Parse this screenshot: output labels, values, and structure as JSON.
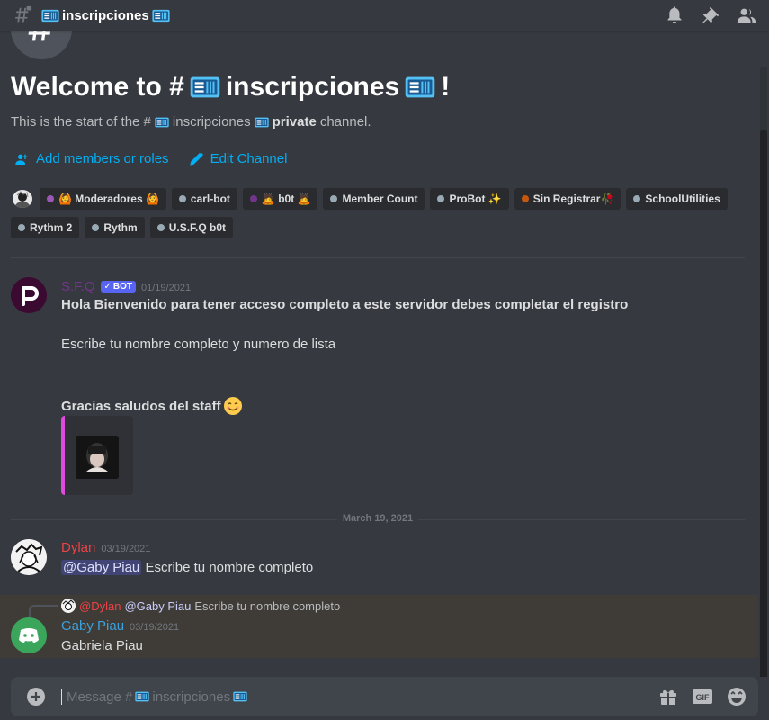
{
  "header": {
    "channel_name": "inscripciones",
    "icons": [
      "notification-bell-icon",
      "pin-icon",
      "member-list-icon"
    ]
  },
  "welcome": {
    "title_prefix": "Welcome to #",
    "channel_name": "inscripciones",
    "title_suffix": "!",
    "sub_prefix": "This is the start of the #",
    "sub_channel": "inscripciones",
    "sub_bold": "private",
    "sub_suffix": "channel.",
    "add_members_label": "Add members or roles",
    "edit_channel_label": "Edit Channel"
  },
  "roles": [
    {
      "label": "🙆 Moderadores 🙆",
      "color": "#9b59b6"
    },
    {
      "label": "carl-bot",
      "color": "#99aab5"
    },
    {
      "label": "🙇 b0t 🙇",
      "color": "#71368a"
    },
    {
      "label": "Member Count",
      "color": "#99aab5"
    },
    {
      "label": "ProBot ✨",
      "color": "#99aab5"
    },
    {
      "label": "Sin Registrar🥀",
      "color": "#c6580d"
    },
    {
      "label": "SchoolUtilities",
      "color": "#99aab5"
    },
    {
      "label": "Rythm 2",
      "color": "#99aab5"
    },
    {
      "label": "Rythm",
      "color": "#99aab5"
    },
    {
      "label": "U.S.F.Q b0t",
      "color": "#99aab5"
    }
  ],
  "messages": [
    {
      "author": "S.F.Q",
      "author_color": "#71368a",
      "bot_tag": "BOT",
      "timestamp": "01/19/2021",
      "line1": "Hola Bienvenido para tener acceso completo a este servidor debes completar el registro",
      "line2": "Escribe tu nombre completo y numero de lista",
      "line3": "Gracias saludos del staff"
    },
    {
      "author": "Dylan",
      "author_color": "#ed4245",
      "timestamp": "03/19/2021",
      "mention": "@Gaby Piau",
      "text": "Escribe tu nombre completo"
    },
    {
      "author": "Gaby Piau",
      "author_color": "#3ba0dc",
      "timestamp": "03/19/2021",
      "text": "Gabriela Piau",
      "reply_author": "@Dylan",
      "reply_mention": "@Gaby Piau",
      "reply_text": "Escribe tu nombre completo"
    }
  ],
  "date_divider": "March 19, 2021",
  "composer": {
    "placeholder_prefix": "Message #",
    "placeholder_channel": "inscripciones",
    "gif_label": "GIF"
  }
}
